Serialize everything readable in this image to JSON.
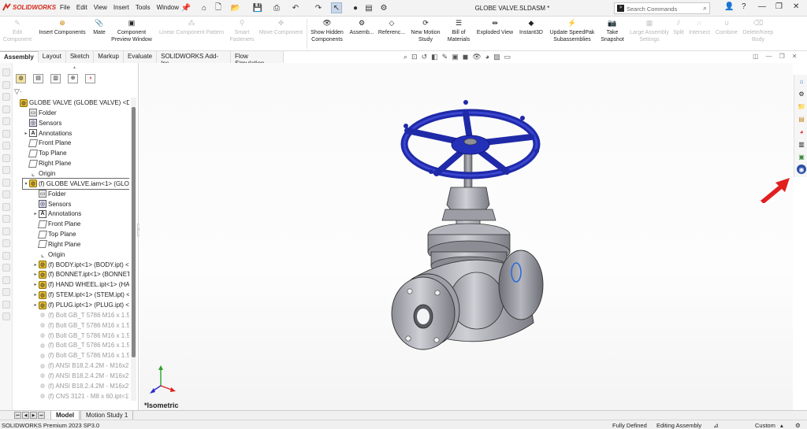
{
  "app": {
    "brand": "SOLIDWORKS",
    "document_title": "GLOBE VALVE.SLDASM *"
  },
  "menu": [
    "File",
    "Edit",
    "View",
    "Insert",
    "Tools",
    "Window"
  ],
  "search": {
    "placeholder": "Search Commands"
  },
  "ribbon": [
    {
      "label": "Edit Component",
      "enabled": false
    },
    {
      "label": "Insert Components",
      "enabled": true
    },
    {
      "label": "Mate",
      "enabled": true
    },
    {
      "label": "Component Preview Window",
      "enabled": true
    },
    {
      "label": "Linear Component Pattern",
      "enabled": false
    },
    {
      "label": "Smart Fasteners",
      "enabled": false
    },
    {
      "label": "Move Component",
      "enabled": false
    },
    {
      "label": "Show Hidden Components",
      "enabled": true
    },
    {
      "label": "Assemb...",
      "enabled": true
    },
    {
      "label": "Referenc...",
      "enabled": true
    },
    {
      "label": "New Motion Study",
      "enabled": true
    },
    {
      "label": "Bill of Materials",
      "enabled": true
    },
    {
      "label": "Exploded View",
      "enabled": true
    },
    {
      "label": "Instant3D",
      "enabled": true
    },
    {
      "label": "Update SpeedPak Subassemblies",
      "enabled": true
    },
    {
      "label": "Take Snapshot",
      "enabled": true
    },
    {
      "label": "Large Assembly Settings",
      "enabled": false
    },
    {
      "label": "Split",
      "enabled": false
    },
    {
      "label": "Intersect",
      "enabled": false
    },
    {
      "label": "Combine",
      "enabled": false
    },
    {
      "label": "Delete/Keep Body",
      "enabled": false
    }
  ],
  "tabs": [
    "Assembly",
    "Layout",
    "Sketch",
    "Markup",
    "Evaluate",
    "SOLIDWORKS Add-Ins",
    "Flow Simulation"
  ],
  "active_tab": "Assembly",
  "tree": [
    {
      "text": "GLOBE VALVE (GLOBE VALVE) <Displ",
      "icon": "assembly",
      "indent": 0,
      "arrow": ""
    },
    {
      "text": "Folder",
      "icon": "folder",
      "indent": 1,
      "arrow": ""
    },
    {
      "text": "Sensors",
      "icon": "sensor",
      "indent": 1,
      "arrow": ""
    },
    {
      "text": "Annotations",
      "icon": "annotation",
      "indent": 1,
      "arrow": "▸"
    },
    {
      "text": "Front Plane",
      "icon": "plane",
      "indent": 1,
      "arrow": ""
    },
    {
      "text": "Top Plane",
      "icon": "plane",
      "indent": 1,
      "arrow": ""
    },
    {
      "text": "Right Plane",
      "icon": "plane",
      "indent": 1,
      "arrow": ""
    },
    {
      "text": "Origin",
      "icon": "origin",
      "indent": 1,
      "arrow": ""
    },
    {
      "text": "(f) GLOBE VALVE.iam<1> (GLOBE",
      "icon": "assembly",
      "indent": 1,
      "arrow": "▾",
      "selected": true
    },
    {
      "text": "Folder",
      "icon": "folder",
      "indent": 2,
      "arrow": ""
    },
    {
      "text": "Sensors",
      "icon": "sensor",
      "indent": 2,
      "arrow": ""
    },
    {
      "text": "Annotations",
      "icon": "annotation",
      "indent": 2,
      "arrow": "▸"
    },
    {
      "text": "Front Plane",
      "icon": "plane",
      "indent": 2,
      "arrow": ""
    },
    {
      "text": "Top Plane",
      "icon": "plane",
      "indent": 2,
      "arrow": ""
    },
    {
      "text": "Right Plane",
      "icon": "plane",
      "indent": 2,
      "arrow": ""
    },
    {
      "text": "Origin",
      "icon": "origin",
      "indent": 2,
      "arrow": ""
    },
    {
      "text": "(f) BODY.ipt<1> (BODY.ipt) <<",
      "icon": "assembly",
      "indent": 2,
      "arrow": "▸"
    },
    {
      "text": "(f) BONNET.ipt<1> (BONNET.i",
      "icon": "assembly",
      "indent": 2,
      "arrow": "▸"
    },
    {
      "text": "(f) HAND WHEEL.ipt<1> (HAN",
      "icon": "assembly",
      "indent": 2,
      "arrow": "▸"
    },
    {
      "text": "(f) STEM.ipt<1> (STEM.ipt) <<",
      "icon": "assembly",
      "indent": 2,
      "arrow": "▸"
    },
    {
      "text": "(f) PLUG.ipt<1> (PLUG.ipt) <<D",
      "icon": "assembly",
      "indent": 2,
      "arrow": "▸"
    },
    {
      "text": "(f) Bolt GB_T 5786 M16 x 1.5 x",
      "icon": "bolt",
      "indent": 2,
      "arrow": "",
      "grey": true
    },
    {
      "text": "(f) Bolt GB_T 5786 M16 x 1.5 x",
      "icon": "bolt",
      "indent": 2,
      "arrow": "",
      "grey": true
    },
    {
      "text": "(f) Bolt GB_T 5786 M16 x 1.5 x",
      "icon": "bolt",
      "indent": 2,
      "arrow": "",
      "grey": true
    },
    {
      "text": "(f) Bolt GB_T 5786 M16 x 1.5 x",
      "icon": "bolt",
      "indent": 2,
      "arrow": "",
      "grey": true
    },
    {
      "text": "(f) Bolt GB_T 5786 M16 x 1.5 x",
      "icon": "bolt",
      "indent": 2,
      "arrow": "",
      "grey": true
    },
    {
      "text": "(f) ANSI B18.2.4.2M - M16x2 - :",
      "icon": "bolt",
      "indent": 2,
      "arrow": "",
      "grey": true
    },
    {
      "text": "(f) ANSI B18.2.4.2M - M16x2 - :",
      "icon": "bolt",
      "indent": 2,
      "arrow": "",
      "grey": true
    },
    {
      "text": "(f) ANSI B18.2.4.2M - M16x2 - :",
      "icon": "bolt",
      "indent": 2,
      "arrow": "",
      "grey": true
    },
    {
      "text": "(f) CNS 3121 - M8 x 60.ipt<1>",
      "icon": "bolt",
      "indent": 2,
      "arrow": "",
      "grey": true
    }
  ],
  "viewport": {
    "view_label": "*Isometric"
  },
  "bottom_tabs": [
    "Model",
    "Motion Study 1"
  ],
  "active_bottom_tab": "Model",
  "status": {
    "product": "SOLIDWORKS Premium 2023 SP3.0",
    "definition": "Fully Defined",
    "mode": "Editing Assembly",
    "units": "Custom"
  },
  "colors": {
    "accent_red": "#d52b1e",
    "wheel_blue": "#1f2aa8",
    "body_grey": "#b8b9c0"
  }
}
